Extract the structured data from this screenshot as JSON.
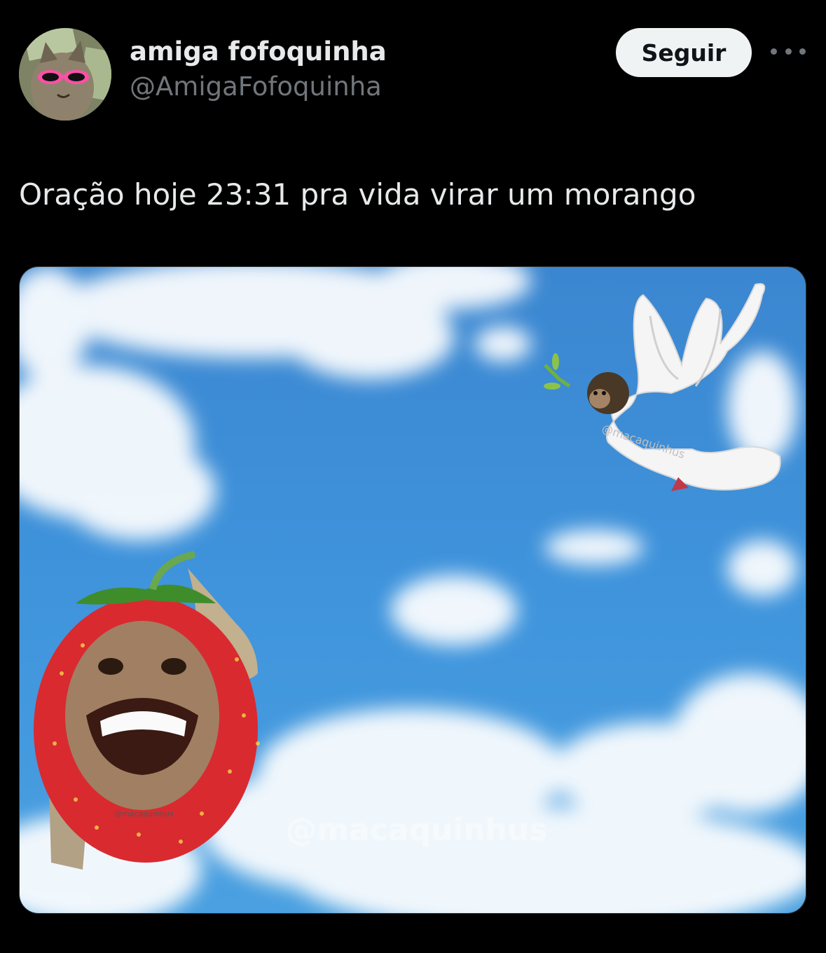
{
  "author": {
    "display_name": "amiga fofoquinha",
    "handle": "@AmigaFofoquinha",
    "avatar_icon": "cat-with-sunglasses-and-money-avatar"
  },
  "actions": {
    "follow_label": "Seguir",
    "more_icon": "ellipsis-icon"
  },
  "tweet": {
    "text": "Oração hoje 23:31 pra vida virar um morango"
  },
  "media": {
    "description_icons": [
      "sky-clouds",
      "dove-with-monkey-head",
      "strawberry-monkey-character"
    ],
    "watermark_main": "@macaquinhus",
    "watermark_dove": "@macaquinhus",
    "watermark_strawberry": "@macaquinhus"
  },
  "colors": {
    "background": "#000000",
    "text_primary": "#e7e9ea",
    "text_secondary": "#71767b",
    "follow_button_bg": "#eff3f4",
    "follow_button_text": "#0f1419",
    "sky": "#3d8fd6"
  }
}
